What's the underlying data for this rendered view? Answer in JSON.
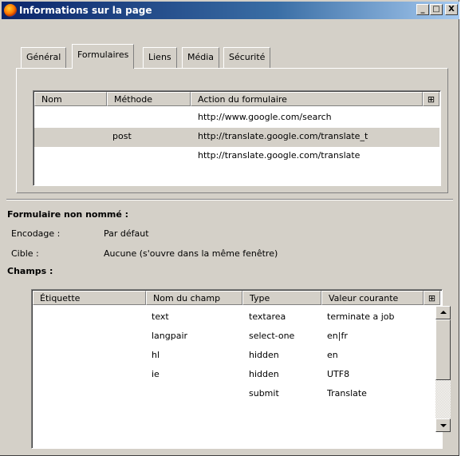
{
  "window": {
    "title": "Informations sur la page",
    "controls": {
      "minimize": "_",
      "maximize": "□",
      "close": "X"
    }
  },
  "tabs": [
    {
      "label": "Général",
      "active": false
    },
    {
      "label": "Formulaires",
      "active": true
    },
    {
      "label": "Liens",
      "active": false
    },
    {
      "label": "Média",
      "active": false
    },
    {
      "label": "Sécurité",
      "active": false
    }
  ],
  "forms_table": {
    "columns": [
      "Nom",
      "Méthode",
      "Action du formulaire"
    ],
    "column_picker_icon": "column-picker-icon",
    "rows": [
      {
        "name": "",
        "method": "",
        "action": "http://www.google.com/search"
      },
      {
        "name": "",
        "method": "post",
        "action": "http://translate.google.com/translate_t"
      },
      {
        "name": "",
        "method": "",
        "action": "http://translate.google.com/translate"
      }
    ],
    "selected_row": 1
  },
  "form_details": {
    "heading": "Formulaire non nommé :",
    "encoding_label": "Encodage :",
    "encoding_value": "Par défaut",
    "target_label": "Cible :",
    "target_value": "Aucune (s'ouvre dans la même fenêtre)"
  },
  "fields": {
    "heading": "Champs :",
    "columns": [
      "Étiquette",
      "Nom du champ",
      "Type",
      "Valeur courante"
    ],
    "rows": [
      {
        "label": "",
        "name": "text",
        "type": "textarea",
        "value": "terminate a job"
      },
      {
        "label": "",
        "name": "langpair",
        "type": "select-one",
        "value": "en|fr"
      },
      {
        "label": "",
        "name": "hl",
        "type": "hidden",
        "value": "en"
      },
      {
        "label": "",
        "name": "ie",
        "type": "hidden",
        "value": "UTF8"
      },
      {
        "label": "",
        "name": "",
        "type": "submit",
        "value": "Translate"
      }
    ]
  }
}
